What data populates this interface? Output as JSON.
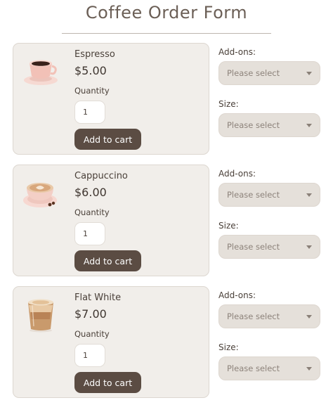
{
  "page": {
    "title": "Coffee Order Form"
  },
  "labels": {
    "quantity": "Quantity",
    "add_to_cart": "Add to cart",
    "addons": "Add-ons:",
    "size": "Size:",
    "select_placeholder": "Please select"
  },
  "products": [
    {
      "name": "Espresso",
      "price": "$5.00",
      "quantity": "1",
      "image_icon": "espresso-cup-icon"
    },
    {
      "name": "Cappuccino",
      "price": "$6.00",
      "quantity": "1",
      "image_icon": "cappuccino-cup-icon"
    },
    {
      "name": "Flat White",
      "price": "$7.00",
      "quantity": "1",
      "image_icon": "flat-white-glass-icon"
    }
  ],
  "colors": {
    "accent_button": "#5b4c43",
    "card_background": "#f1eeea",
    "select_background": "#e5e0da"
  }
}
